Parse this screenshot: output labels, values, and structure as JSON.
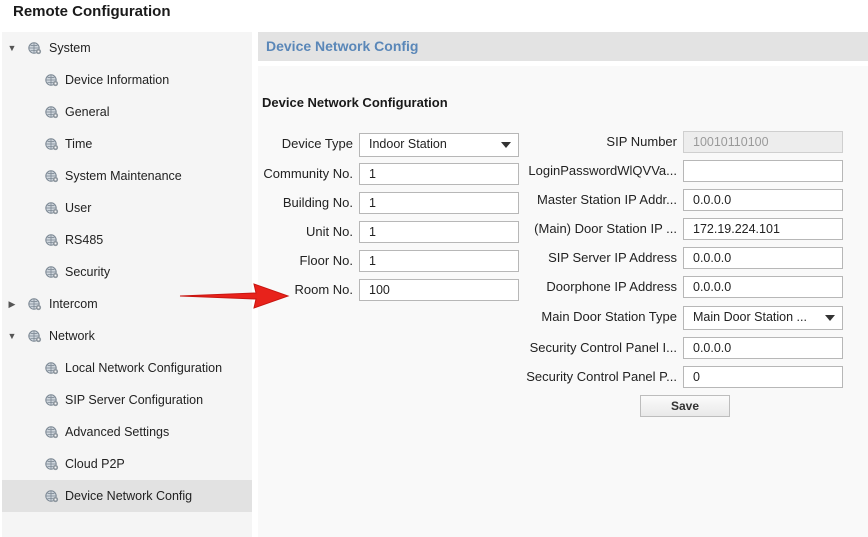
{
  "window": {
    "title": "Remote Configuration"
  },
  "sidebar": {
    "groups": [
      {
        "label": "System",
        "expanded": true,
        "items": [
          {
            "label": "Device Information"
          },
          {
            "label": "General"
          },
          {
            "label": "Time"
          },
          {
            "label": "System Maintenance"
          },
          {
            "label": "User"
          },
          {
            "label": "RS485"
          },
          {
            "label": "Security"
          }
        ]
      },
      {
        "label": "Intercom",
        "expanded": false,
        "items": []
      },
      {
        "label": "Network",
        "expanded": true,
        "items": [
          {
            "label": "Local Network Configuration"
          },
          {
            "label": "SIP Server Configuration"
          },
          {
            "label": "Advanced Settings"
          },
          {
            "label": "Cloud P2P"
          },
          {
            "label": "Device Network Config",
            "selected": true
          }
        ]
      }
    ]
  },
  "content": {
    "header": "Device Network Config",
    "section_title": "Device Network Configuration",
    "left_fields": [
      {
        "label": "Device Type",
        "value": "Indoor Station",
        "type": "select"
      },
      {
        "label": "Community No.",
        "value": "1"
      },
      {
        "label": "Building No.",
        "value": "1"
      },
      {
        "label": "Unit No.",
        "value": "1"
      },
      {
        "label": "Floor No.",
        "value": "1"
      },
      {
        "label": "Room No.",
        "value": "100"
      }
    ],
    "right_fields": [
      {
        "label": "SIP Number",
        "value": "10010110100",
        "disabled": true
      },
      {
        "label": "LoginPasswordWlQVVa...",
        "value": ""
      },
      {
        "label": "Master Station IP Addr...",
        "value": "0.0.0.0"
      },
      {
        "label": "(Main) Door Station IP ...",
        "value": "172.19.224.101"
      },
      {
        "label": "SIP Server IP Address",
        "value": "0.0.0.0"
      },
      {
        "label": "Doorphone IP Address",
        "value": "0.0.0.0"
      },
      {
        "label": "Main Door Station Type",
        "value": "Main Door Station ...",
        "type": "select"
      },
      {
        "label": "Security Control Panel I...",
        "value": "0.0.0.0"
      },
      {
        "label": "Security Control Panel P...",
        "value": "0"
      }
    ],
    "save_label": "Save"
  },
  "colors": {
    "header_text": "#5a87b8",
    "annotation_arrow": "#e8221b"
  },
  "icons": {
    "tree_node": "globe-gear-icon",
    "expand": "triangle-arrow-icon"
  }
}
